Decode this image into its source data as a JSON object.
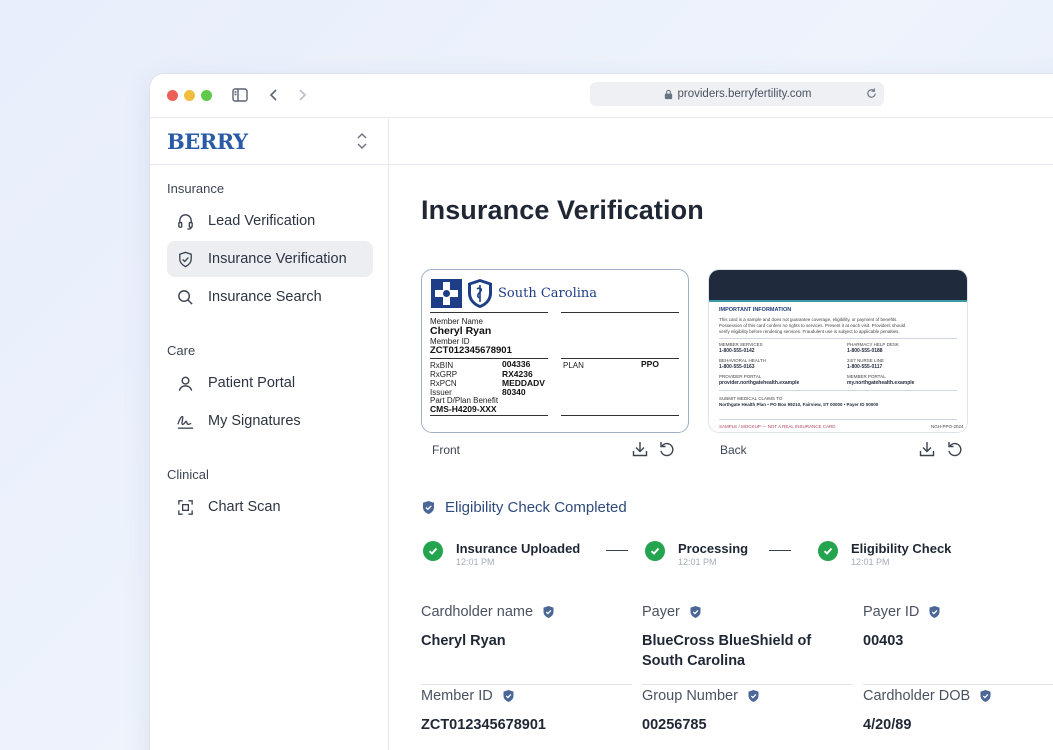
{
  "browser": {
    "url": "providers.berryfertility.com"
  },
  "sidebar": {
    "logo": "BERRY",
    "sections": [
      {
        "label": "Insurance",
        "items": [
          {
            "label": "Lead Verification",
            "icon": "headset-icon"
          },
          {
            "label": "Insurance Verification",
            "icon": "shield-check-icon",
            "active": true
          },
          {
            "label": "Insurance Search",
            "icon": "search-icon"
          }
        ]
      },
      {
        "label": "Care",
        "items": [
          {
            "label": "Patient Portal",
            "icon": "user-icon"
          },
          {
            "label": "My Signatures",
            "icon": "signature-icon"
          }
        ]
      },
      {
        "label": "Clinical",
        "items": [
          {
            "label": "Chart Scan",
            "icon": "scan-icon"
          }
        ]
      }
    ]
  },
  "main": {
    "title": "Insurance Verification",
    "front_card": {
      "caption": "Front",
      "state": "South Carolina",
      "member_name_label": "Member Name",
      "member_name": "Cheryl Ryan",
      "member_id_label": "Member ID",
      "member_id": "ZCT012345678901",
      "rxbin_label": "RxBIN",
      "rxbin": "004336",
      "rxgrp_label": "RxGRP",
      "rxgrp": "RX4236",
      "rxpcn_label": "RxPCN",
      "rxpcn": "MEDDADV",
      "issuer_label": "Issuer",
      "issuer": "80340",
      "partd_label": "Part D/Plan Benefit",
      "partd": "CMS-H4209-XXX",
      "plan_label": "PLAN",
      "plan": "PPO"
    },
    "back_card": {
      "caption": "Back",
      "header": "IMPORTANT INFORMATION",
      "body1": "This card is a sample and does not guarantee coverage, eligibility, or payment of benefits.",
      "body2": "Possession of this card confers no rights to services. Present it at each visit. Providers should",
      "body3": "verify eligibility before rendering services. Fraudulent use is subject to applicable penalties.",
      "c1_label": "MEMBER SERVICES",
      "c1_val": "1-800-555-0142",
      "c2_label": "PHARMACY HELP DESK",
      "c2_val": "1-800-555-0188",
      "c3_label": "BEHAVIORAL HEALTH",
      "c3_val": "1-800-555-0163",
      "c4_label": "24/7 NURSE LINE",
      "c4_val": "1-800-555-0117",
      "c5_label": "PROVIDER PORTAL",
      "c5_val": "provider.northgatehealth.example",
      "c6_label": "MEMBER PORTAL",
      "c6_val": "my.northgatehealth.example",
      "claims_label": "SUBMIT MEDICAL CLAIMS TO",
      "claims_val": "Northgate Health Plan  •  PO Box 99210, Fairview, ST 00000  •  Payer ID 00000",
      "footer_left": "SAMPLE / MOCKUP — NOT A REAL INSURANCE CARD",
      "footer_right": "NGH-PPO-2024"
    },
    "eligibility_status": "Eligibility Check Completed",
    "steps": [
      {
        "title": "Insurance Uploaded",
        "time": "12:01 PM"
      },
      {
        "title": "Processing",
        "time": "12:01 PM"
      },
      {
        "title": "Eligibility Check",
        "time": "12:01 PM"
      }
    ],
    "fields": [
      {
        "label": "Cardholder name",
        "value": "Cheryl Ryan"
      },
      {
        "label": "Payer",
        "value": "BlueCross BlueShield of South Carolina"
      },
      {
        "label": "Payer ID",
        "value": "00403"
      },
      {
        "label": "Member ID",
        "value": "ZCT012345678901"
      },
      {
        "label": "Group Number",
        "value": "00256785"
      },
      {
        "label": "Cardholder DOB",
        "value": "4/20/89"
      }
    ]
  },
  "colors": {
    "accent": "#2b5aa6",
    "success": "#25a44f",
    "verified_shield": "#4a6797"
  }
}
